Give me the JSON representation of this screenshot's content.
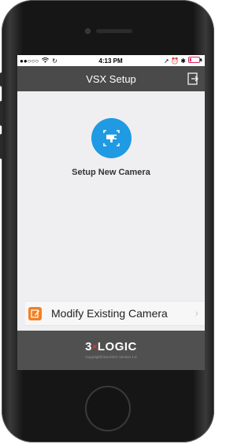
{
  "status_bar": {
    "signal": "●●○○○",
    "time": "4:13 PM",
    "right_icons": "➚ ⏰ ✱"
  },
  "nav": {
    "title": "VSX Setup",
    "exit_icon": "exit-icon"
  },
  "setup": {
    "label": "Setup New Camera",
    "icon": "camera-scan-icon"
  },
  "modify": {
    "label": "Modify Existing Camera",
    "icon": "edit-icon",
    "chevron": "›"
  },
  "footer": {
    "logo_left": "3",
    "logo_x": "×",
    "logo_right": "LOGIC",
    "copyright": "Copyright©3xLOGIC  Version 1.0"
  },
  "colors": {
    "nav_bg": "#4a4a4a",
    "accent_blue": "#1f9ae3",
    "accent_orange": "#f57f20",
    "logo_red": "#e53c2e"
  }
}
